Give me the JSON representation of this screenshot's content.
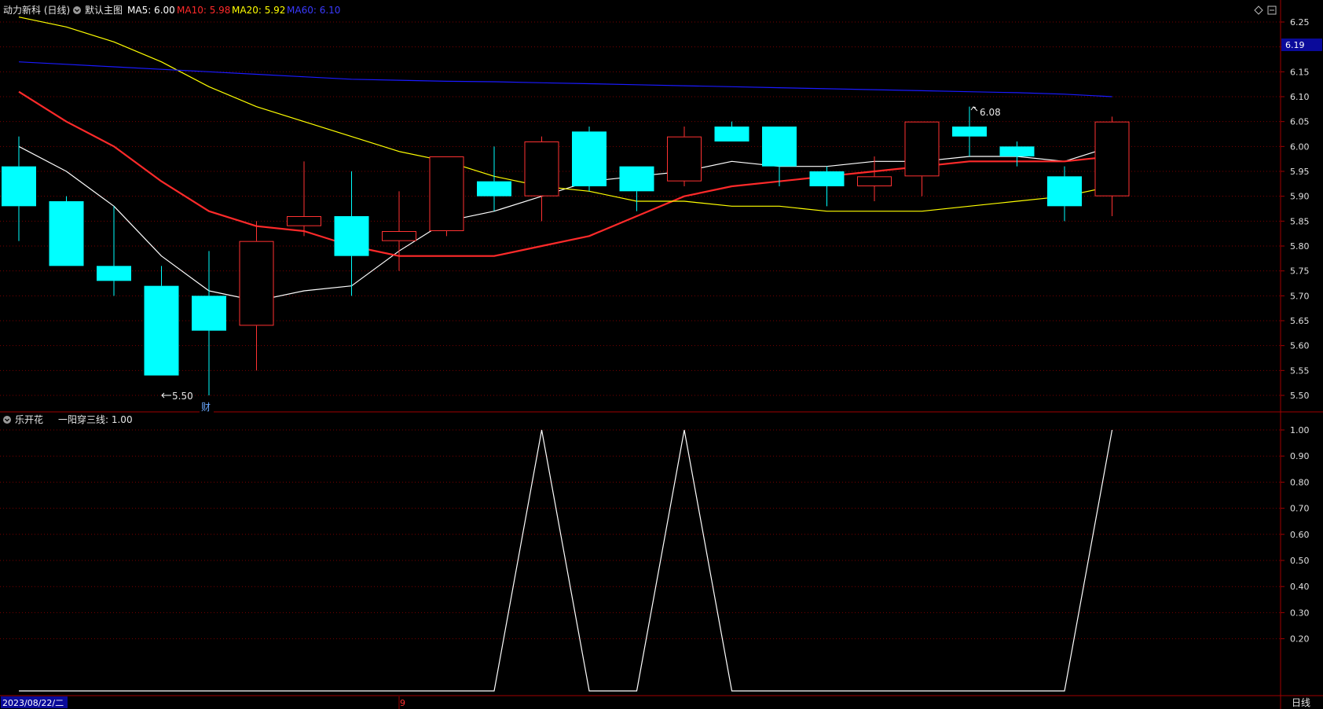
{
  "main_panel": {
    "stock_name": "动力新科 (日线)",
    "template_label": "默认主图",
    "ma_labels": [
      {
        "text": "MA5: 6.00",
        "color": "#ffffff"
      },
      {
        "text": "MA10: 5.98",
        "color": "#ff2a2a"
      },
      {
        "text": "MA20: 5.92",
        "color": "#ffff00"
      },
      {
        "text": "MA60: 6.10",
        "color": "#1a1aff"
      }
    ],
    "price_tag": "6.19",
    "high_annotation": "6.08",
    "low_annotation": "5.50",
    "finance_marker": "财"
  },
  "sub_panel": {
    "indicator_name": "乐开花",
    "indicator_label": "一阳穿三线: 1.00"
  },
  "footer": {
    "start_date": "2023/08/22/二",
    "month_marker": "9",
    "period_label": "日线"
  },
  "colors": {
    "up": "#ff3232",
    "down": "#00ffff",
    "ma5": "#ffffff",
    "ma10": "#ff2a2a",
    "ma20": "#ffff00",
    "ma60": "#1a1aff",
    "grid": "#7a0000",
    "frame": "#a00000"
  },
  "chart_data": [
    {
      "type": "candlestick",
      "title": "动力新科 (日线)",
      "ylim": [
        5.47,
        6.27
      ],
      "y_ticks": [
        "6.25",
        "6.20",
        "6.15",
        "6.10",
        "6.05",
        "6.00",
        "5.95",
        "5.90",
        "5.85",
        "5.80",
        "5.75",
        "5.70",
        "5.65",
        "5.60",
        "5.55",
        "5.50"
      ],
      "candles": [
        {
          "open": 5.96,
          "high": 6.02,
          "low": 5.81,
          "close": 5.88
        },
        {
          "open": 5.89,
          "high": 5.9,
          "low": 5.76,
          "close": 5.76
        },
        {
          "open": 5.76,
          "high": 5.88,
          "low": 5.7,
          "close": 5.73
        },
        {
          "open": 5.72,
          "high": 5.76,
          "low": 5.54,
          "close": 5.54
        },
        {
          "open": 5.7,
          "high": 5.79,
          "low": 5.5,
          "close": 5.63
        },
        {
          "open": 5.64,
          "high": 5.85,
          "low": 5.55,
          "close": 5.81
        },
        {
          "open": 5.84,
          "high": 5.97,
          "low": 5.82,
          "close": 5.86
        },
        {
          "open": 5.86,
          "high": 5.95,
          "low": 5.7,
          "close": 5.78
        },
        {
          "open": 5.81,
          "high": 5.91,
          "low": 5.75,
          "close": 5.83
        },
        {
          "open": 5.83,
          "high": 5.98,
          "low": 5.82,
          "close": 5.98
        },
        {
          "open": 5.93,
          "high": 6.0,
          "low": 5.87,
          "close": 5.9
        },
        {
          "open": 5.9,
          "high": 6.02,
          "low": 5.85,
          "close": 6.01
        },
        {
          "open": 6.03,
          "high": 6.04,
          "low": 5.91,
          "close": 5.92
        },
        {
          "open": 5.96,
          "high": 5.96,
          "low": 5.87,
          "close": 5.91
        },
        {
          "open": 5.93,
          "high": 6.04,
          "low": 5.92,
          "close": 6.02
        },
        {
          "open": 6.04,
          "high": 6.05,
          "low": 6.01,
          "close": 6.01
        },
        {
          "open": 6.04,
          "high": 6.04,
          "low": 5.92,
          "close": 5.96
        },
        {
          "open": 5.95,
          "high": 5.96,
          "low": 5.88,
          "close": 5.92
        },
        {
          "open": 5.92,
          "high": 5.98,
          "low": 5.89,
          "close": 5.94
        },
        {
          "open": 5.94,
          "high": 6.05,
          "low": 5.9,
          "close": 6.05
        },
        {
          "open": 6.04,
          "high": 6.08,
          "low": 5.98,
          "close": 6.02
        },
        {
          "open": 6.0,
          "high": 6.01,
          "low": 5.96,
          "close": 5.98
        },
        {
          "open": 5.94,
          "high": 5.96,
          "low": 5.85,
          "close": 5.88
        },
        {
          "open": 5.9,
          "high": 6.06,
          "low": 5.86,
          "close": 6.05
        }
      ],
      "series": [
        {
          "name": "MA5",
          "color": "#ffffff",
          "values": [
            6.0,
            5.95,
            5.88,
            5.78,
            5.71,
            5.69,
            5.71,
            5.72,
            5.79,
            5.85,
            5.87,
            5.9,
            5.93,
            5.94,
            5.95,
            5.97,
            5.96,
            5.96,
            5.97,
            5.97,
            5.98,
            5.98,
            5.97,
            6.0
          ]
        },
        {
          "name": "MA10",
          "color": "#ff2a2a",
          "values": [
            6.11,
            6.05,
            6.0,
            5.93,
            5.87,
            5.84,
            5.83,
            5.8,
            5.78,
            5.78,
            5.78,
            5.8,
            5.82,
            5.86,
            5.9,
            5.92,
            5.93,
            5.94,
            5.95,
            5.96,
            5.97,
            5.97,
            5.97,
            5.98
          ]
        },
        {
          "name": "MA20",
          "color": "#ffff00",
          "values": [
            6.26,
            6.24,
            6.21,
            6.17,
            6.12,
            6.08,
            6.05,
            6.02,
            5.99,
            5.97,
            5.94,
            5.92,
            5.91,
            5.89,
            5.89,
            5.88,
            5.88,
            5.87,
            5.87,
            5.87,
            5.88,
            5.89,
            5.9,
            5.92
          ]
        },
        {
          "name": "MA60",
          "color": "#1a1aff",
          "values": [
            6.17,
            6.165,
            6.16,
            6.155,
            6.15,
            6.145,
            6.14,
            6.135,
            6.133,
            6.131,
            6.13,
            6.128,
            6.126,
            6.124,
            6.122,
            6.12,
            6.118,
            6.116,
            6.114,
            6.112,
            6.11,
            6.108,
            6.105,
            6.1
          ]
        }
      ]
    },
    {
      "type": "line",
      "title": "乐开花",
      "ylim": [
        0.0,
        1.03
      ],
      "y_ticks": [
        "1.00",
        "0.90",
        "0.80",
        "0.70",
        "0.60",
        "0.50",
        "0.40",
        "0.30",
        "0.20"
      ],
      "series": [
        {
          "name": "一阳穿三线",
          "color": "#ffffff",
          "values": [
            0,
            0,
            0,
            0,
            0,
            0,
            0,
            0,
            0,
            0,
            0,
            1,
            0,
            0,
            1,
            0,
            0,
            0,
            0,
            0,
            0,
            0,
            0,
            1
          ]
        }
      ]
    }
  ]
}
